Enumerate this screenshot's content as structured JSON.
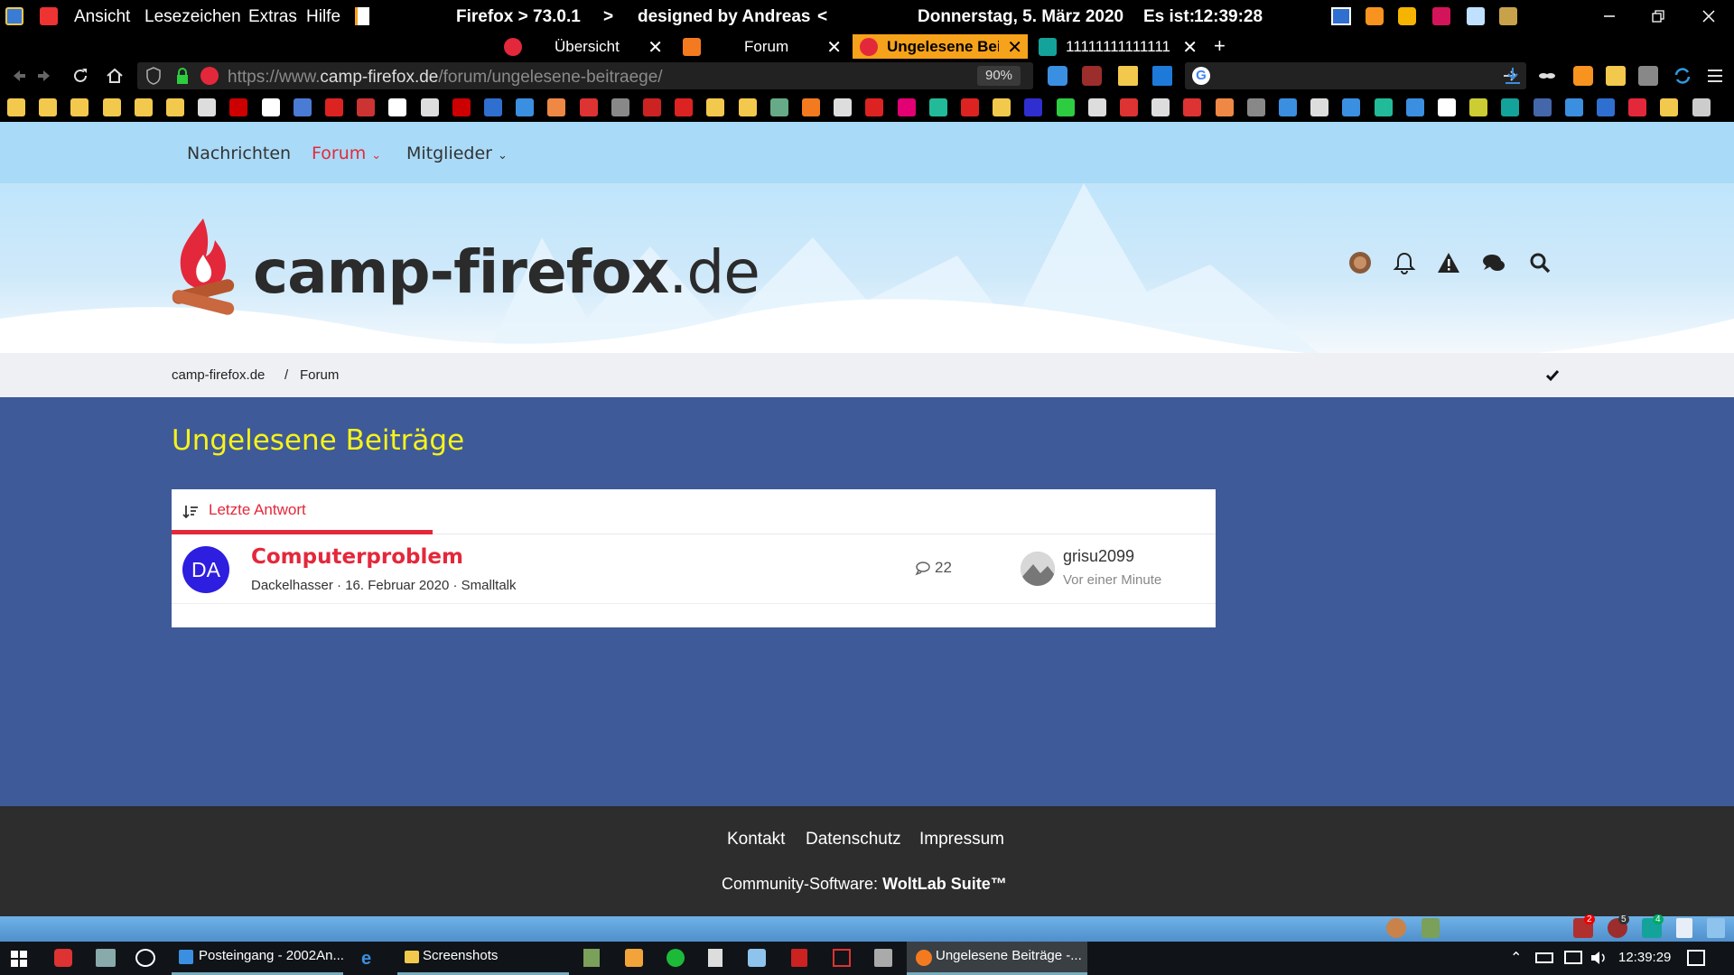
{
  "titlebar": {
    "menu": [
      "Ansicht",
      "Lesezeichen",
      "Extras",
      "Hilfe"
    ],
    "browser_version": "Firefox > 73.0.1",
    "arrow_right": ">",
    "designer": "designed by Andreas",
    "arrow_left": "<",
    "date": "Donnerstag, 5. März 2020",
    "time_label": "Es ist:",
    "time": "12:39:28"
  },
  "tabs": [
    {
      "label": "Übersicht",
      "icon": "firefox-camp-icon",
      "active": false
    },
    {
      "label": "Forum",
      "icon": "ff-icon",
      "active": false
    },
    {
      "label": "Ungelesene Beit",
      "icon": "campfire-icon",
      "active": true
    },
    {
      "label": "11111111111111",
      "icon": "s-icon",
      "active": false
    }
  ],
  "navbar": {
    "url_prefix": "https://www.",
    "url_domain": "camp-firefox.de",
    "url_path": "/forum/ungelesene-beitraege/",
    "zoom": "90%"
  },
  "topnav": {
    "items": [
      "Nachrichten",
      "Forum",
      "Mitglieder"
    ],
    "active_color": "#e4283b"
  },
  "header": {
    "logo_main": "camp-firefox",
    "logo_tld": ".de"
  },
  "breadcrumb": {
    "home": "camp-firefox.de",
    "separator": "/",
    "current": "Forum"
  },
  "page": {
    "title": "Ungelesene Beiträge",
    "title_color": "#f7f31a",
    "sort_label": "Letzte Antwort",
    "thread": {
      "avatar_initials": "DA",
      "title": "Computerproblem",
      "author": "Dackelhasser",
      "separator": "·",
      "date": "16. Februar 2020",
      "board": "Smalltalk",
      "replies": "22",
      "last_user": "grisu2099",
      "last_time": "Vor einer Minute"
    }
  },
  "footer": {
    "links": [
      "Kontakt",
      "Datenschutz",
      "Impressum"
    ],
    "software_prefix": "Community-Software:",
    "software_name": "WoltLab Suite™"
  },
  "taskbar": {
    "items": [
      "Posteingang - 2002An...",
      "Screenshots",
      "Ungelesene Beiträge -..."
    ],
    "clock": "12:39:29",
    "badges": [
      "2",
      "5",
      "4"
    ]
  }
}
